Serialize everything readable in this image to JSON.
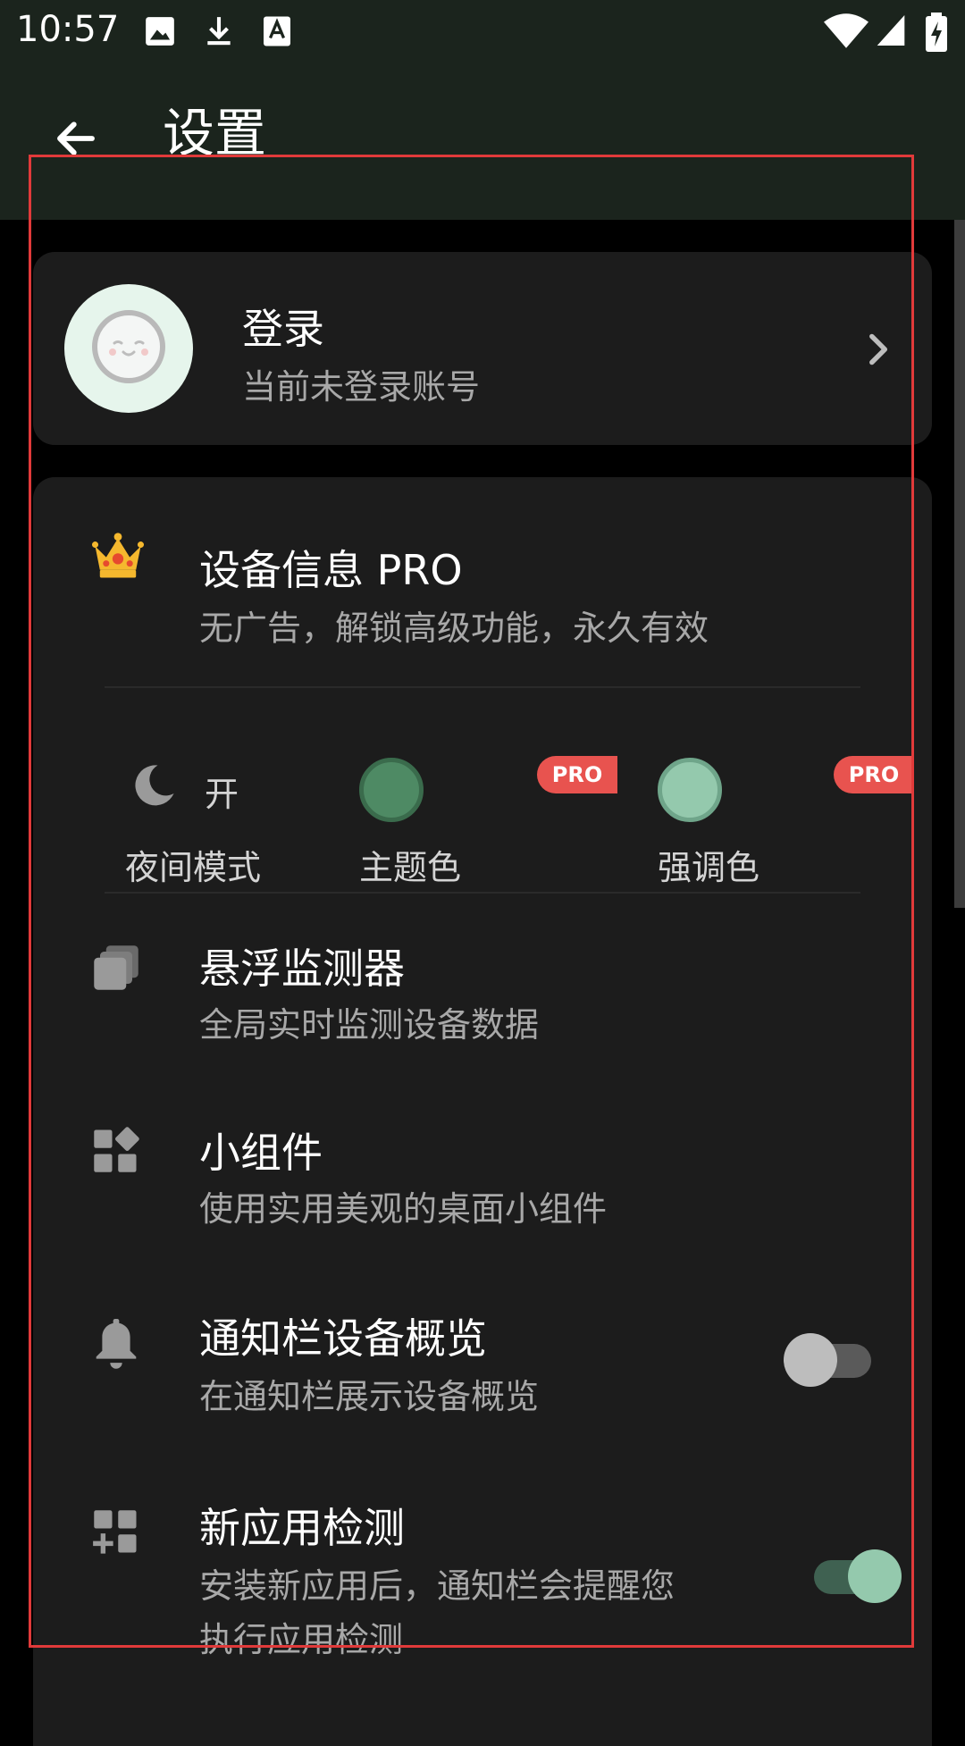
{
  "status_bar": {
    "time": "10:57",
    "left_icons": [
      "image-icon",
      "download-icon",
      "font-icon"
    ],
    "right_icons": [
      "wifi-icon",
      "signal-icon",
      "battery-charging-icon"
    ]
  },
  "app_bar": {
    "title": "设置",
    "back_icon": "arrow-back-icon"
  },
  "login_card": {
    "title": "登录",
    "subtitle": "当前未登录账号",
    "avatar_icon": "smiley-face-icon",
    "chevron_icon": "chevron-right-icon"
  },
  "pro_row": {
    "title": "设备信息 PRO",
    "subtitle": "无广告，解锁高级功能，永久有效",
    "icon": "crown-icon"
  },
  "appearance": {
    "night_mode": {
      "label": "夜间模式",
      "value": "开",
      "icon": "moon-icon"
    },
    "theme_color": {
      "label": "主题色",
      "color": "#4e8a64",
      "badge": "PRO"
    },
    "accent_color": {
      "label": "强调色",
      "color": "#94c9ad",
      "badge": "PRO"
    }
  },
  "rows": [
    {
      "title": "悬浮监测器",
      "subtitle": "全局实时监测设备数据",
      "icon": "overlay-windows-icon"
    },
    {
      "title": "小组件",
      "subtitle": "使用实用美观的桌面小组件",
      "icon": "widgets-icon"
    },
    {
      "title": "通知栏设备概览",
      "subtitle": "在通知栏展示设备概览",
      "icon": "bell-icon",
      "toggle": false
    },
    {
      "title": "新应用检测",
      "subtitle_line1": "安装新应用后，通知栏会提醒您",
      "subtitle_line2": "执行应用检测",
      "icon": "add-app-icon",
      "toggle": true
    }
  ],
  "colors": {
    "app_bar": "#1b241d",
    "card": "#1c1c1c",
    "pro_badge": "#e8534f",
    "accent": "#94c9ad",
    "highlight_box": "#e13a3a"
  }
}
